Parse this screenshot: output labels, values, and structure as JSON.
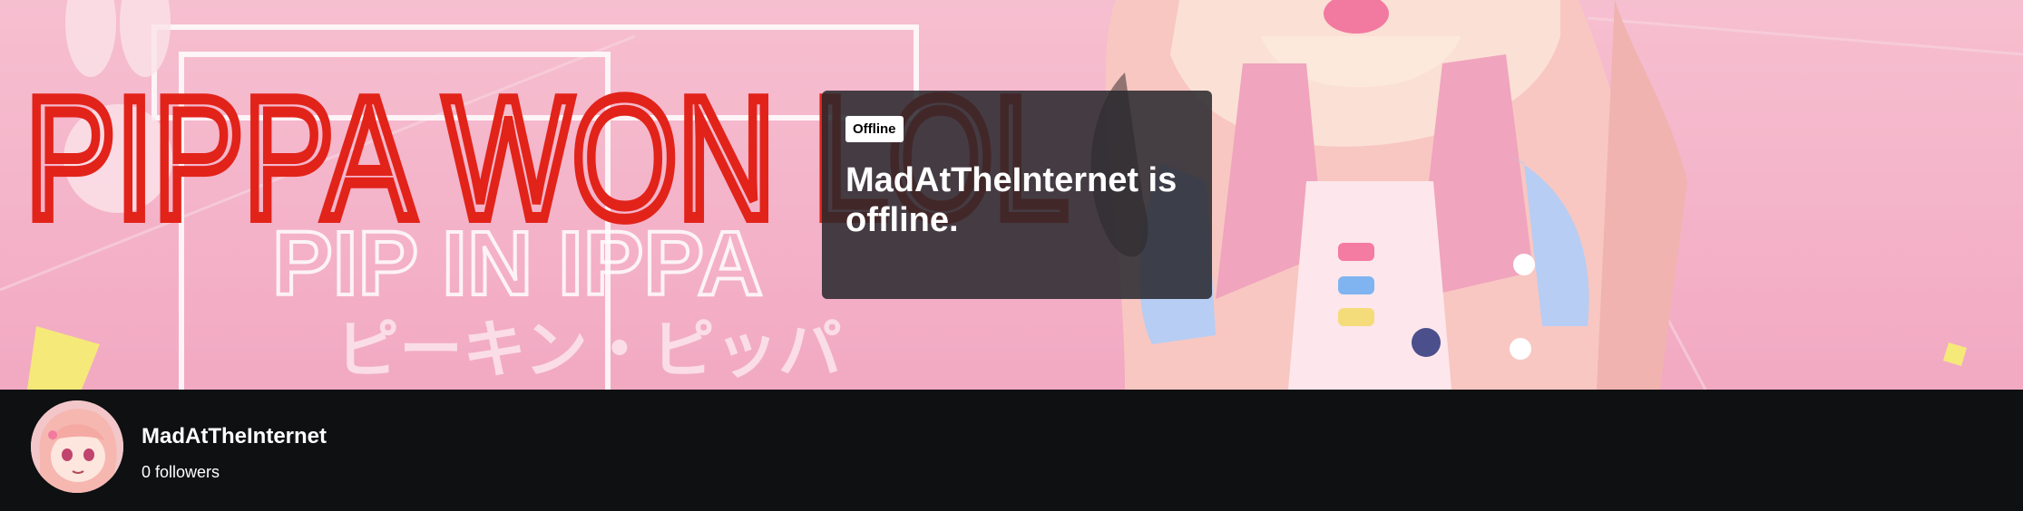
{
  "banner": {
    "graffiti_text": "PIPPA WON LOL",
    "outline_text": "PIP IN IPPA",
    "kana_text": "ピーキン・ピッパ",
    "bg_color": "#f4b3c8",
    "graffiti_color": "#e2231a"
  },
  "offline_card": {
    "badge": "Offline",
    "message": "MadAtTheInternet is offline."
  },
  "channel": {
    "name": "MadAtTheInternet",
    "followers": "0 followers"
  }
}
